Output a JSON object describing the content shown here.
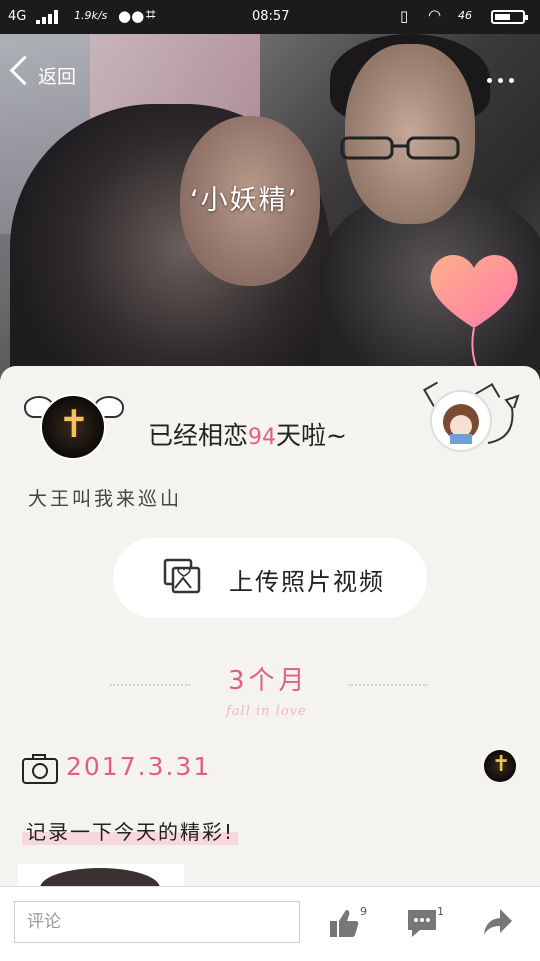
{
  "status_bar": {
    "network": "4G",
    "speed": "1.9k/s",
    "time": "08:57",
    "battery_label": "46"
  },
  "header": {
    "back_label": "返回",
    "couple_name": "‘小妖精’"
  },
  "card": {
    "love_prefix": "已经相恋",
    "love_days": "94",
    "love_suffix": "天啦~",
    "motto": "大王叫我来巡山",
    "upload_label": "上传照片视频",
    "month_label": "3个月",
    "fall_in_love": "fall in love"
  },
  "post": {
    "date": "2017.3.31",
    "text": "记录一下今天的精彩!"
  },
  "bottom_bar": {
    "comment_placeholder": "评论",
    "like_count": "9",
    "comment_count": "1"
  },
  "colors": {
    "accent_pink": "#e0607e",
    "card_bg": "#f4f3ef"
  }
}
